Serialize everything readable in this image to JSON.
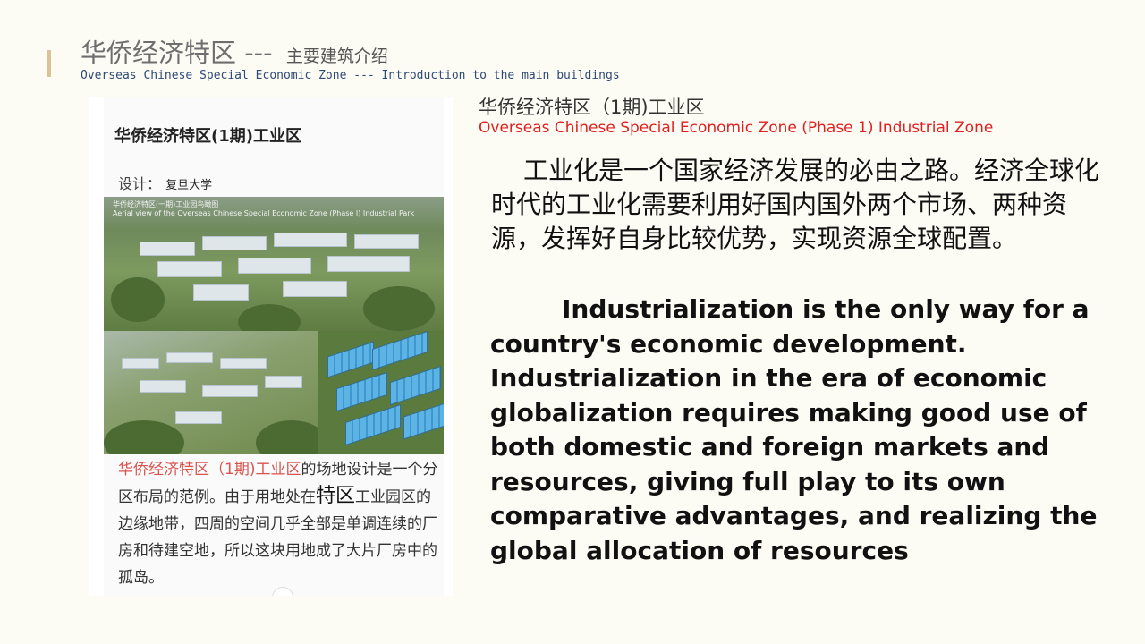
{
  "header": {
    "title_zh": "华侨经济特区 ---",
    "title_zh_sub": "主要建筑介绍",
    "title_en": "Overseas Chinese Special Economic Zone --- Introduction to the main buildings"
  },
  "card": {
    "title": "华侨经济特区(1期)工业区",
    "design_label": "设计：",
    "design_value": "复旦大学",
    "aerial_caption_zh": "华侨经济特区(一期)工业园鸟瞰图",
    "aerial_caption_en": "Aerial view of the Overseas Chinese Special Economic Zone (Phase I) Industrial Park",
    "desc_highlight": "华侨经济特区（1期)工业区",
    "desc_1": "的场地设计是一个分区布局的范例。由于用地处在",
    "desc_big_1": "特",
    "desc_big_2": "区",
    "desc_2": "工业园区的边缘地带，四周的空间几乎全部是单调连续的厂房和待建空地，所以这块用地成了大片厂房中的孤岛。"
  },
  "section": {
    "heading_zh": "华侨经济特区（1期)工业区",
    "heading_en": "Overseas Chinese Special Economic Zone (Phase 1) Industrial Zone",
    "para_zh": "工业化是一个国家经济发展的必由之路。经济全球化时代的工业化需要利用好国内国外两个市场、两种资源，发挥好自身比较优势，实现资源全球配置。",
    "para_en": "Industrialization is the only way for a country's economic development. Industrialization in the era of economic globalization requires making good use of both domestic and foreign markets and resources, giving full play to its own comparative advantages, and realizing the global allocation of resources"
  },
  "colors": {
    "accent": "#d8c497",
    "title_en": "#2f4a77",
    "heading_en": "#e02020",
    "highlight": "#d9534f"
  }
}
